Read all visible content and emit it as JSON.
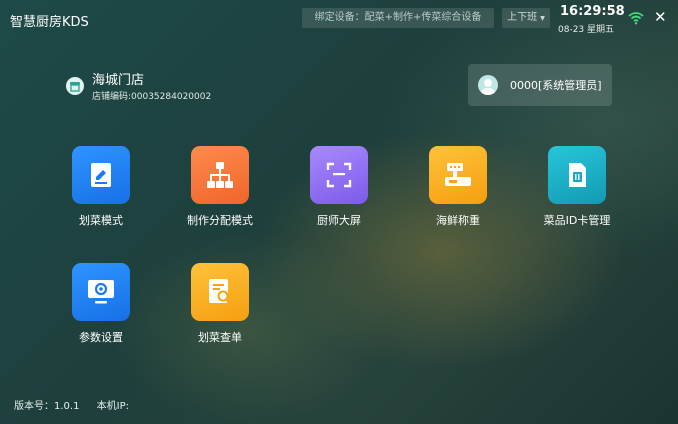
{
  "header": {
    "app_title": "智慧厨房KDS",
    "device_binding": "绑定设备：配菜+制作+传菜综合设备",
    "shift_button": "上下班",
    "time": "16:29:58",
    "date": "08-23 星期五",
    "wifi_icon": "wifi-icon",
    "close_icon": "close-icon"
  },
  "store": {
    "name": "海城门店",
    "code": "店铺编码:00035284020002"
  },
  "user": {
    "name": "0000[系统管理员]"
  },
  "tiles": [
    {
      "label": "划菜模式",
      "icon": "edit-document-icon",
      "color": "#2182f5"
    },
    {
      "label": "制作分配模式",
      "icon": "hierarchy-icon",
      "color": "#f7733a"
    },
    {
      "label": "厨师大屏",
      "icon": "fullscreen-icon",
      "color": "#9072f5"
    },
    {
      "label": "海鲜称重",
      "icon": "scale-icon",
      "color": "#f9b023"
    },
    {
      "label": "菜品ID卡管理",
      "icon": "sim-card-icon",
      "color": "#1db3c9"
    },
    {
      "label": "参数设置",
      "icon": "monitor-settings-icon",
      "color": "#2182f5"
    },
    {
      "label": "划菜查单",
      "icon": "search-document-icon",
      "color": "#f9b023"
    }
  ],
  "footer": {
    "version": "版本号：1.0.1",
    "ip": "本机IP:"
  }
}
